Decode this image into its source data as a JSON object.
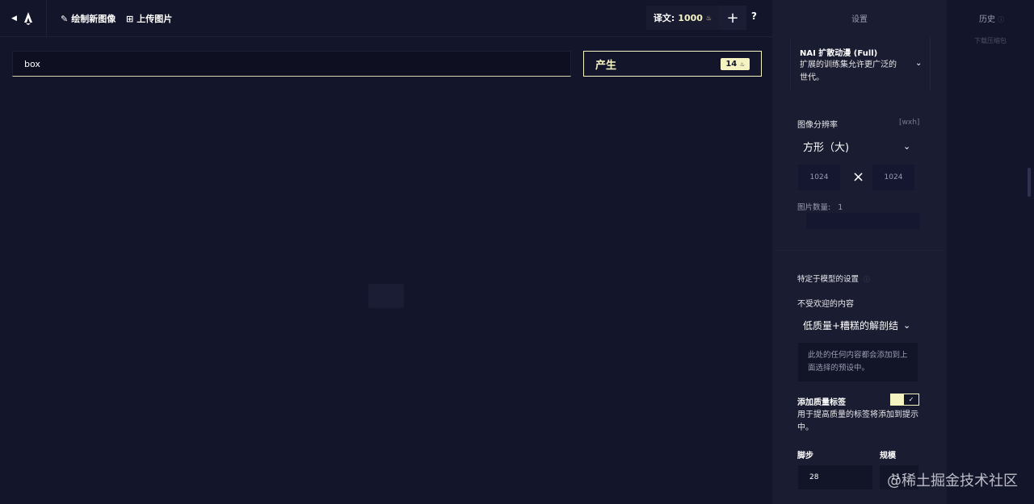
{
  "topbar": {
    "back_icon": "chevron-left-icon",
    "logo_icon": "novelai-logo-icon",
    "draw_new_label": "绘制新图像",
    "draw_new_icon": "pencil-icon",
    "upload_label": "上传图片",
    "upload_icon": "upload-icon",
    "anlas_label": "译文:",
    "anlas_value": "1000",
    "anlas_icon": "anlas-icon",
    "plus_label": "+",
    "help_label": "?"
  },
  "prompt": {
    "value": "box"
  },
  "generate": {
    "label": "产生",
    "cost": "14"
  },
  "settings": {
    "title": "设置",
    "model": {
      "name": "NAI 扩散动漫 (Full)",
      "description": "扩展的训练集允许更广泛的世代。"
    },
    "resolution": {
      "label": "图像分辨率",
      "hint": "[wxh]",
      "preset": "方形（大)",
      "width": "1024",
      "height": "1024",
      "times": "×"
    },
    "image_count": {
      "label": "图片数量:",
      "value": "1"
    },
    "model_specific": {
      "label": "特定于模型的设置",
      "info_icon": "help-circle-icon"
    },
    "undesired": {
      "label": "不受欢迎的内容",
      "preset": "低质量+糟糕的解剖结",
      "placeholder": "此处的任何内容都会添加到上面选择的预设中。"
    },
    "quality_tags": {
      "label": "添加质量标签",
      "enabled": true,
      "check": "✓",
      "description": "用于提高质量的标签将添加到提示中。"
    },
    "steps": {
      "label": "脚步",
      "value": "28"
    },
    "scale": {
      "label": "规模",
      "value": "11"
    }
  },
  "history": {
    "title": "历史",
    "download_label": "下载压缩包"
  },
  "watermark": "@稀土掘金技术社区",
  "colors": {
    "accent": "#f5f3c2",
    "background": "#13152a",
    "panel": "#1a1c31"
  }
}
